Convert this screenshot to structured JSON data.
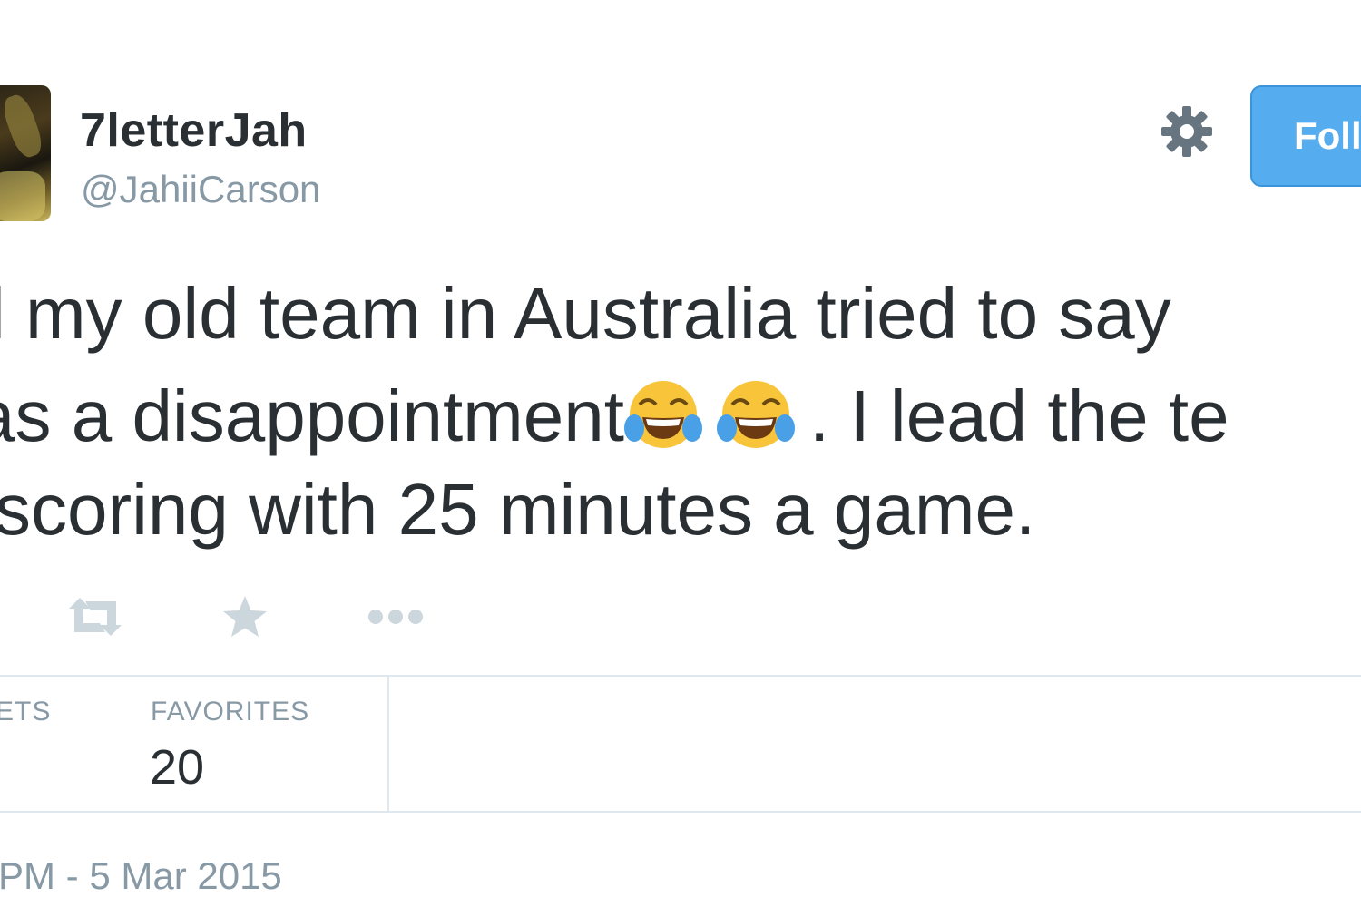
{
  "tweet": {
    "author": {
      "display_name": "7letterJah",
      "handle": "@JahiiCarson",
      "avatar_icon": "profile-photo"
    },
    "header": {
      "settings_icon": "gear-icon",
      "follow_label": "Foll"
    },
    "text": {
      "line1": "l my old team in Australia tried to say",
      "line2_start": "as a disappointment",
      "line2_emoji": "face-with-tears-of-joy",
      "line2_end": ". I lead the te",
      "line3": "scoring with 25 minutes a game."
    },
    "actions": [
      {
        "name": "retweet",
        "icon": "retweet-icon"
      },
      {
        "name": "favorite",
        "icon": "star-icon"
      },
      {
        "name": "more",
        "icon": "more-icon"
      }
    ],
    "stats": {
      "retweets_label": "EETS",
      "favorites_label": "FAVORITES",
      "favorites_value": "20"
    },
    "timestamp": "PM - 5 Mar 2015",
    "colors": {
      "text": "#292f33",
      "muted": "#8899a6",
      "follow_button": "#55acee",
      "divider": "#e1e8ed",
      "icon": "#ccd6dd",
      "gear": "#66757f"
    }
  }
}
